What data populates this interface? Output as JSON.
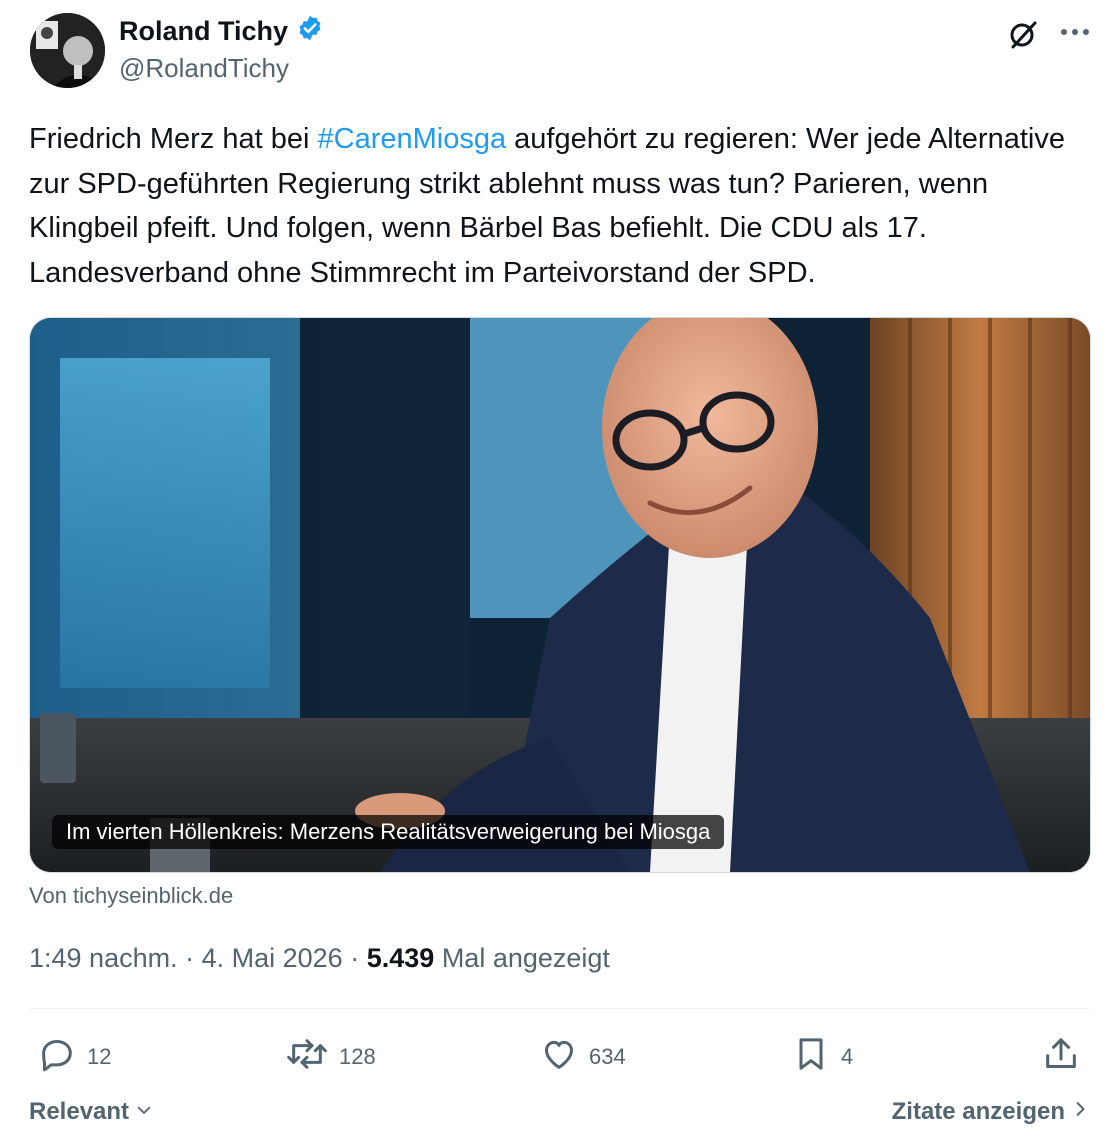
{
  "author": {
    "name": "Roland Tichy",
    "handle": "@RolandTichy"
  },
  "tweet": {
    "text_before": "Friedrich Merz hat bei ",
    "hashtag": "#CarenMiosga",
    "text_after": " aufgehört zu regieren: Wer jede Alternative zur SPD-geführten Regierung strikt ablehnt muss was tun? Parieren, wenn Klingbeil pfeift. Und folgen, wenn Bärbel Bas befiehlt. Die CDU als 17. Landesverband ohne Stimmrecht im Parteivorstand der SPD."
  },
  "card": {
    "caption": "Im vierten Höllenkreis: Merzens Realitätsverweigerung bei Miosga",
    "source": "Von tichyseinblick.de"
  },
  "meta": {
    "time": "1:49 nachm.",
    "date": "4. Mai 2026",
    "views": "5.439",
    "views_label": "Mal angezeigt"
  },
  "actions": {
    "replies": "12",
    "reposts": "128",
    "likes": "634",
    "bookmarks": "4"
  },
  "footer": {
    "left": "Relevant",
    "right": "Zitate anzeigen"
  },
  "colors": {
    "accent": "#1d9bf0",
    "secondary_text": "#536471",
    "primary_text": "#0f1419"
  },
  "icons": [
    "verified-badge-icon",
    "grok-icon",
    "more-icon",
    "reply-icon",
    "repost-icon",
    "like-icon",
    "bookmark-icon",
    "share-icon",
    "chevron-down-icon",
    "chevron-right-icon"
  ]
}
